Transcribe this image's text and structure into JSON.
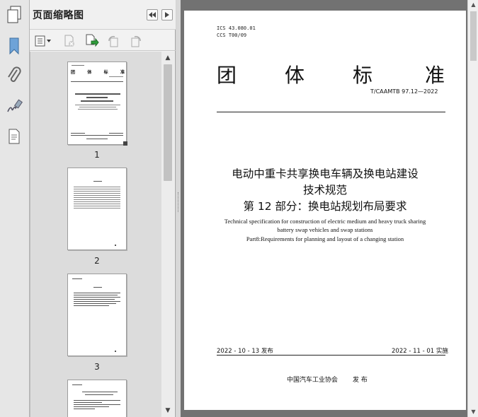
{
  "panel": {
    "title": "页面缩略图"
  },
  "thumbnails": [
    {
      "label": "1"
    },
    {
      "label": "2"
    },
    {
      "label": "3"
    }
  ],
  "document": {
    "ics": "ICS  43.080.01",
    "ccs": "CCS  T00/09",
    "header_chars": [
      "团",
      "体",
      "标",
      "准"
    ],
    "standard_no": "T/CAAMTB 97.12—2022",
    "title_cn_1": "电动中重卡共享换电车辆及换电站建设",
    "title_cn_2": "技术规范",
    "title_cn_3": "第 12 部分：换电站规划布局要求",
    "title_en_1": "Technical specification for construction of electric medium and heavy truck sharing",
    "title_en_2": "battery swap vehicles and swap stations",
    "title_en_3": "Part8:Requirements for planning and layout of a changing station",
    "issue_date": "2022 - 10 - 13 发布",
    "impl_date": "2022 - 11 - 01 实施",
    "publisher": "中国汽车工业协会",
    "publish_word": "发  布"
  },
  "icons": {
    "rail": [
      "page-thumbnails-icon",
      "bookmark-icon",
      "attachment-icon",
      "signature-icon",
      "page-layers-icon"
    ],
    "header": [
      "collapse-left-icon",
      "collapse-right-icon"
    ],
    "toolbar": [
      "options-icon",
      "delete-page-icon",
      "insert-page-icon",
      "rotate-ccw-icon",
      "rotate-cw-icon"
    ]
  }
}
